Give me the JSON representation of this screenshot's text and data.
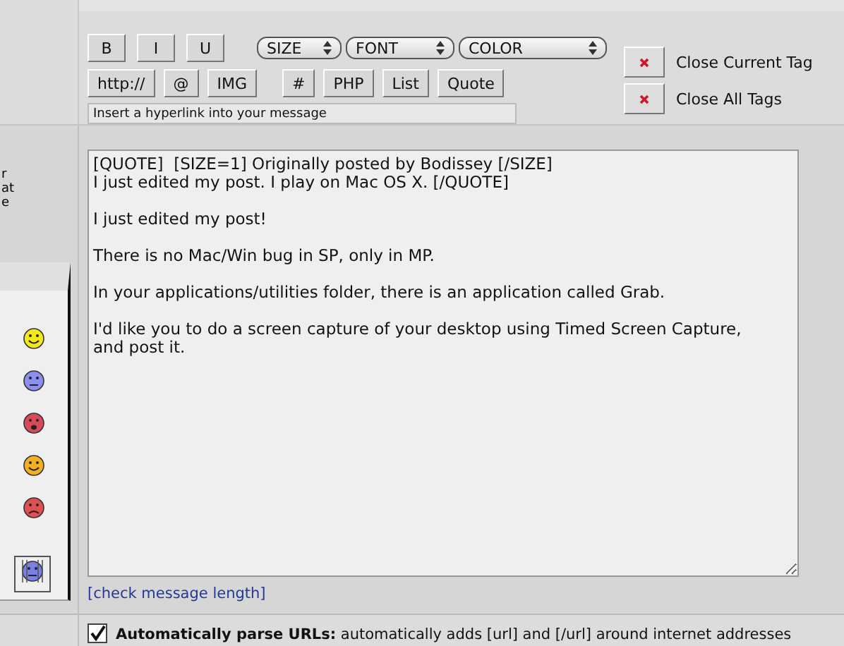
{
  "side_fragments": [
    "r",
    "at",
    "e"
  ],
  "format_buttons": [
    "B",
    "I",
    "U"
  ],
  "selects": [
    {
      "label": "SIZE",
      "kind": "short"
    },
    {
      "label": "FONT",
      "kind": "medium"
    },
    {
      "label": "COLOR",
      "kind": "long"
    }
  ],
  "tag_buttons": [
    "http://",
    "@",
    "IMG",
    "#",
    "PHP",
    "List",
    "Quote"
  ],
  "status_text": "Insert a hyperlink into your message",
  "close_buttons": [
    {
      "label": "Close Current Tag"
    },
    {
      "label": "Close All Tags"
    }
  ],
  "message": "[QUOTE]  [SIZE=1] Originally posted by Bodissey [/SIZE]\nI just edited my post. I play on Mac OS X. [/QUOTE]\n\nI just edited my post!\n\nThere is no Mac/Win bug in SP, only in MP.\n\nIn your applications/utilities folder, there is an application called Grab.\n\nI'd like you to do a screen capture of your desktop using Timed Screen Capture, and post it.",
  "check_link": "[check message length]",
  "option": {
    "checked": true,
    "text": "**Automatically parse URLs:** automatically adds [url] and [/url] around internet addresses"
  }
}
